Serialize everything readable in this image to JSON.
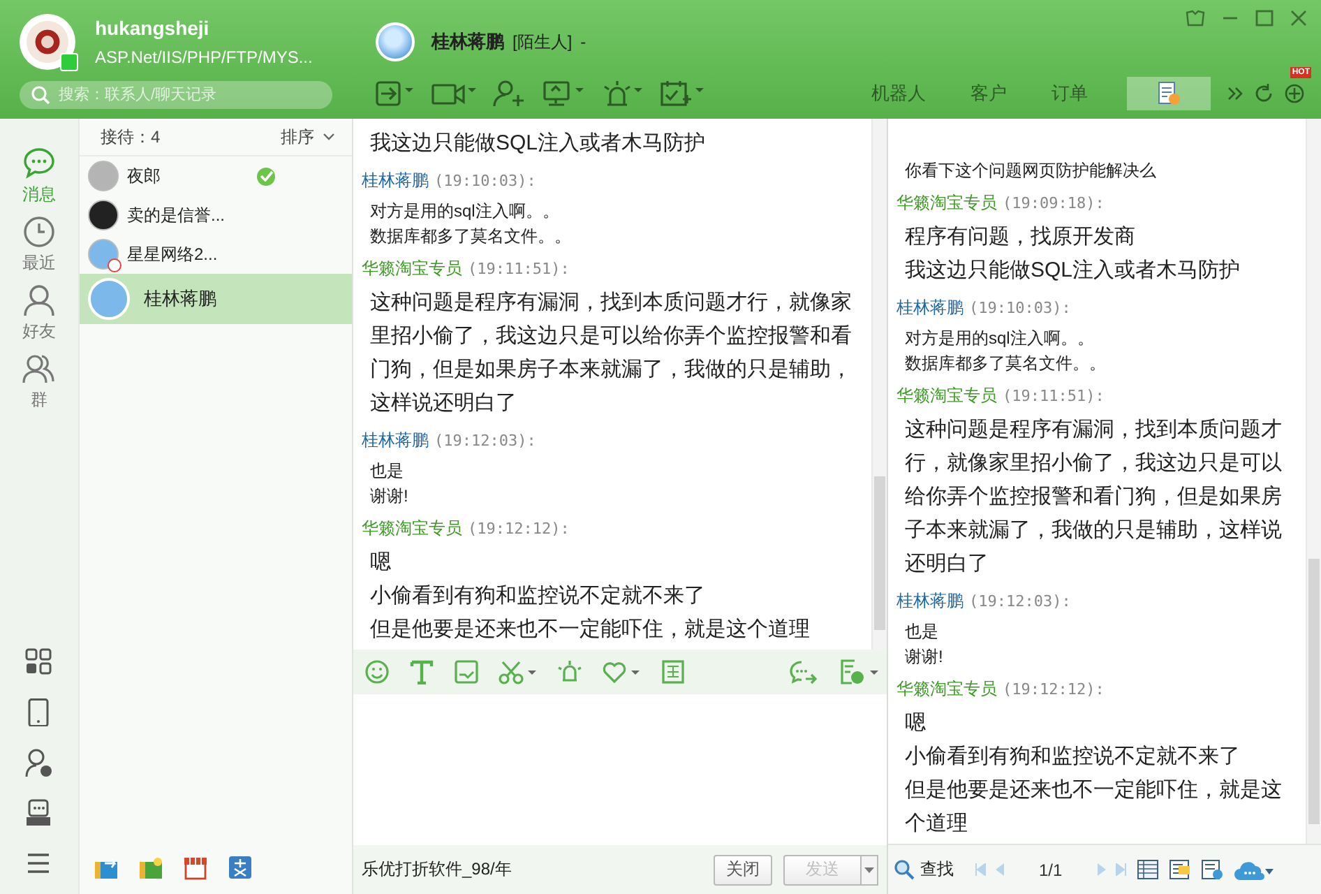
{
  "profile": {
    "name": "hukangsheji",
    "status": "ASP.Net/IIS/PHP/FTP/MYS...",
    "online": true
  },
  "search": {
    "placeholder": "搜索：联系人/聊天记录"
  },
  "chat_header": {
    "name": "桂林蒋鹏",
    "tag": "[陌生人]",
    "suffix": "-"
  },
  "tabs": [
    {
      "kind": "text",
      "label": "机器人",
      "selected": false
    },
    {
      "kind": "text",
      "label": "客户",
      "selected": false
    },
    {
      "kind": "text",
      "label": "订单",
      "selected": false
    },
    {
      "kind": "icon",
      "selected": true
    }
  ],
  "hot_badge": "HOT",
  "nav": [
    {
      "label": "消息",
      "selected": true
    },
    {
      "label": "最近",
      "selected": false
    },
    {
      "label": "好友",
      "selected": false
    },
    {
      "label": "群",
      "selected": false
    }
  ],
  "contacts_header": {
    "count": "接待：4",
    "sort": "排序"
  },
  "contacts": [
    {
      "name": "夜郎",
      "color": "#b4b4b4",
      "verified": true,
      "clock": false,
      "selected": false
    },
    {
      "name": "卖的是信誉...",
      "color": "#222222",
      "verified": false,
      "clock": false,
      "selected": false
    },
    {
      "name": "星星网络2...",
      "color": "#7db8ea",
      "verified": false,
      "clock": true,
      "selected": false
    },
    {
      "name": "桂林蒋鹏",
      "color": "#7db8ea",
      "verified": false,
      "clock": false,
      "selected": true
    }
  ],
  "chat": [
    {
      "kind": "self",
      "lines": [
        "我这边只能做SQL注入或者木马防护"
      ]
    },
    {
      "kind": "other",
      "sender": "桂林蒋鹏",
      "time": "(19:10:03):",
      "lines": [
        "对方是用的sql注入啊。。",
        "数据库都多了莫名文件。。"
      ]
    },
    {
      "kind": "self",
      "sender": "华籁淘宝专员",
      "time": "(19:11:51):",
      "lines": [
        "这种问题是程序有漏洞，找到本质问题才行，就像家里招小偷了，我这边只是可以给你弄个监控报警和看门狗，但是如果房子本来就漏了，我做的只是辅助，这样说还明白了"
      ]
    },
    {
      "kind": "other",
      "sender": "桂林蒋鹏",
      "time": "(19:12:03):",
      "lines": [
        "也是",
        "谢谢!"
      ]
    },
    {
      "kind": "self",
      "sender": "华籁淘宝专员",
      "time": "(19:12:12):",
      "lines": [
        "嗯",
        "小偷看到有狗和监控说不定就不来了",
        "但是他要是还来也不一定能吓住，就是这个道理"
      ]
    }
  ],
  "footer": {
    "ad": "乐优打折软件_98/年",
    "close": "关闭",
    "send": "发送",
    "send_disabled": true
  },
  "history": [
    {
      "kind": "other",
      "lines": [
        "你看下这个问题网页防护能解决么"
      ]
    },
    {
      "kind": "self",
      "sender": "华籁淘宝专员",
      "time": "(19:09:18):",
      "lines": [
        "程序有问题，找原开发商",
        "我这边只能做SQL注入或者木马防护"
      ]
    },
    {
      "kind": "other",
      "sender": "桂林蒋鹏",
      "time": "(19:10:03):",
      "lines": [
        "对方是用的sql注入啊。。",
        "数据库都多了莫名文件。。"
      ]
    },
    {
      "kind": "self",
      "sender": "华籁淘宝专员",
      "time": "(19:11:51):",
      "lines": [
        "这种问题是程序有漏洞，找到本质问题才行，就像家里招小偷了，我这边只是可以给你弄个监控报警和看门狗，但是如果房子本来就漏了，我做的只是辅助，这样说还明白了"
      ]
    },
    {
      "kind": "other",
      "sender": "桂林蒋鹏",
      "time": "(19:12:03):",
      "lines": [
        "也是",
        "谢谢!"
      ]
    },
    {
      "kind": "self",
      "sender": "华籁淘宝专员",
      "time": "(19:12:12):",
      "lines": [
        "嗯",
        "小偷看到有狗和监控说不定就不来了",
        "但是他要是还来也不一定能吓住，就是这个道理"
      ]
    }
  ],
  "history_bar": {
    "find": "查找",
    "page": "1/1"
  }
}
